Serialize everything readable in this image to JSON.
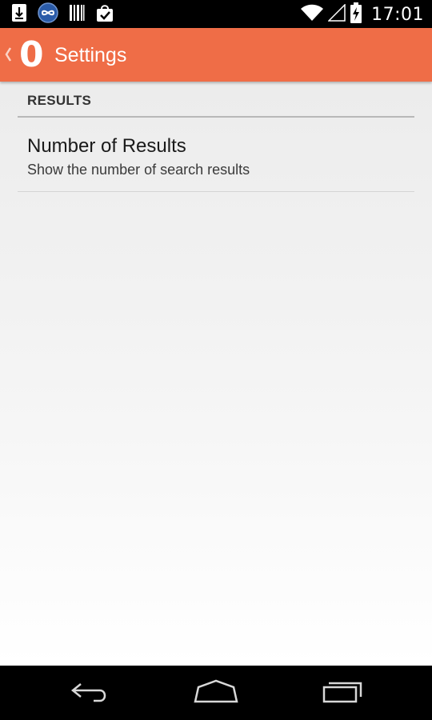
{
  "status_bar": {
    "time": "17:01",
    "left_icons": [
      "download-icon",
      "infinity-icon",
      "barcode-icon",
      "shopping-bag-check-icon"
    ],
    "right_icons": [
      "wifi-icon",
      "signal-icon",
      "battery-charging-icon"
    ]
  },
  "action_bar": {
    "logo_text": "0",
    "title": "Settings",
    "color": "#ef6d47"
  },
  "preferences": {
    "category": "RESULTS",
    "items": [
      {
        "title": "Number of Results",
        "summary": "Show the number of search results"
      }
    ]
  },
  "nav_bar": {
    "buttons": [
      "back-icon",
      "home-icon",
      "recent-apps-icon"
    ]
  }
}
